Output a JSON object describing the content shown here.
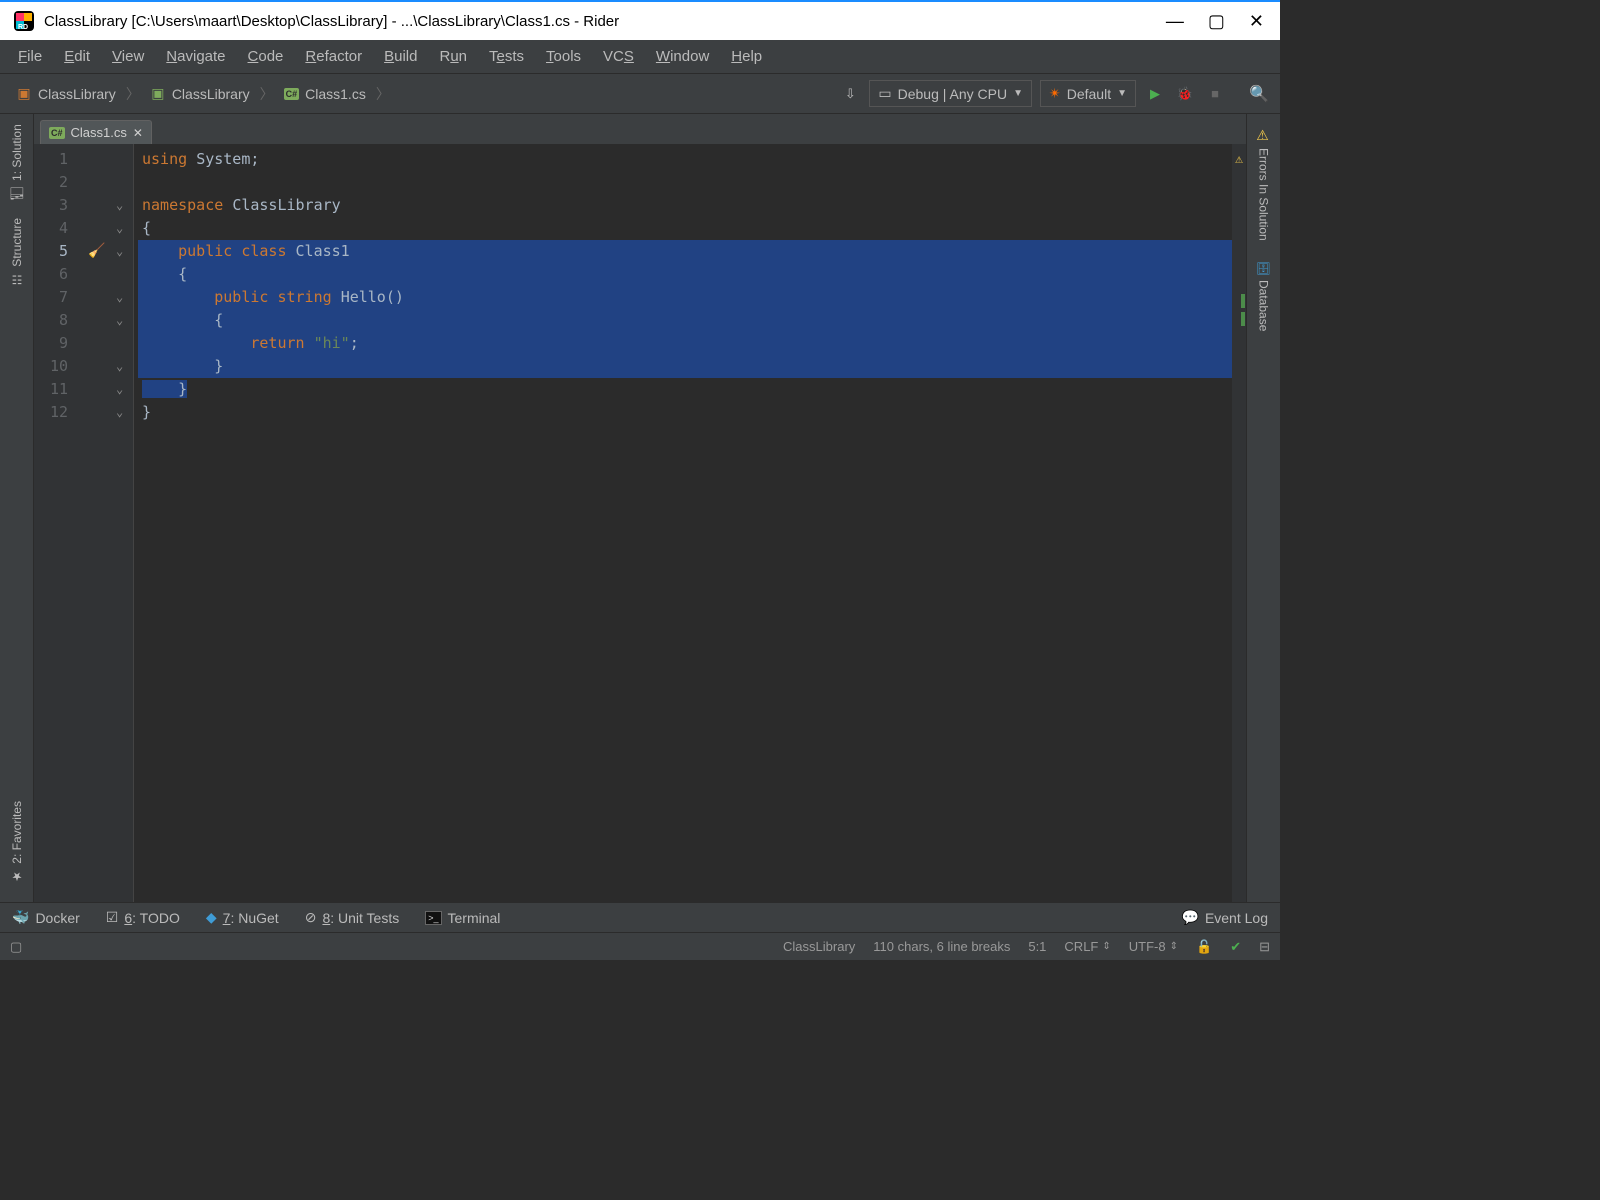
{
  "window": {
    "title": "ClassLibrary [C:\\Users\\maart\\Desktop\\ClassLibrary] - ...\\ClassLibrary\\Class1.cs - Rider"
  },
  "menu": {
    "file": "File",
    "edit": "Edit",
    "view": "View",
    "navigate": "Navigate",
    "code": "Code",
    "refactor": "Refactor",
    "build": "Build",
    "run": "Run",
    "tests": "Tests",
    "tools": "Tools",
    "vcs": "VCS",
    "window": "Window",
    "help": "Help"
  },
  "breadcrumb": {
    "solution": "ClassLibrary",
    "project": "ClassLibrary",
    "file": "Class1.cs"
  },
  "toolbar": {
    "run_config": "Debug | Any CPU",
    "profile": "Default"
  },
  "tabs": {
    "active": "Class1.cs"
  },
  "left_tools": {
    "solution": "1: Solution",
    "structure": "Structure",
    "favorites": "2: Favorites"
  },
  "right_tools": {
    "errors": "Errors In Solution",
    "database": "Database"
  },
  "code": {
    "lines": [
      {
        "n": 1,
        "sel": false,
        "tokens": [
          [
            "kw",
            "using "
          ],
          [
            "ident",
            "System"
          ],
          [
            "punct",
            ";"
          ]
        ]
      },
      {
        "n": 2,
        "sel": false,
        "tokens": []
      },
      {
        "n": 3,
        "sel": false,
        "tokens": [
          [
            "kw",
            "namespace "
          ],
          [
            "ident",
            "ClassLibrary"
          ]
        ]
      },
      {
        "n": 4,
        "sel": false,
        "tokens": [
          [
            "punct",
            "{"
          ]
        ]
      },
      {
        "n": 5,
        "sel": true,
        "cur": true,
        "cleanup": true,
        "tokens": [
          [
            "punct",
            "    "
          ],
          [
            "kw",
            "public class "
          ],
          [
            "ident",
            "Class1"
          ]
        ]
      },
      {
        "n": 6,
        "sel": true,
        "tokens": [
          [
            "punct",
            "    {"
          ]
        ]
      },
      {
        "n": 7,
        "sel": true,
        "tokens": [
          [
            "punct",
            "        "
          ],
          [
            "kw",
            "public "
          ],
          [
            "kw",
            "string "
          ],
          [
            "ident",
            "Hello"
          ],
          [
            "punct",
            "()"
          ]
        ]
      },
      {
        "n": 8,
        "sel": true,
        "tokens": [
          [
            "punct",
            "        {"
          ]
        ]
      },
      {
        "n": 9,
        "sel": true,
        "tokens": [
          [
            "punct",
            "            "
          ],
          [
            "kw",
            "return "
          ],
          [
            "str",
            "\"hi\""
          ],
          [
            "punct",
            ";"
          ]
        ]
      },
      {
        "n": 10,
        "sel": true,
        "tokens": [
          [
            "punct",
            "        }"
          ]
        ]
      },
      {
        "n": 11,
        "sel": true,
        "partial": true,
        "tokens": [
          [
            "punct",
            "    }"
          ]
        ]
      },
      {
        "n": 12,
        "sel": false,
        "tokens": [
          [
            "punct",
            "}"
          ]
        ]
      }
    ]
  },
  "bottom": {
    "docker": "Docker",
    "todo": "6: TODO",
    "nuget": "7: NuGet",
    "unit": "8: Unit Tests",
    "terminal": "Terminal",
    "eventlog": "Event Log"
  },
  "status": {
    "context": "ClassLibrary",
    "chars": "110 chars, 6 line breaks",
    "pos": "5:1",
    "eol": "CRLF",
    "enc": "UTF-8"
  }
}
